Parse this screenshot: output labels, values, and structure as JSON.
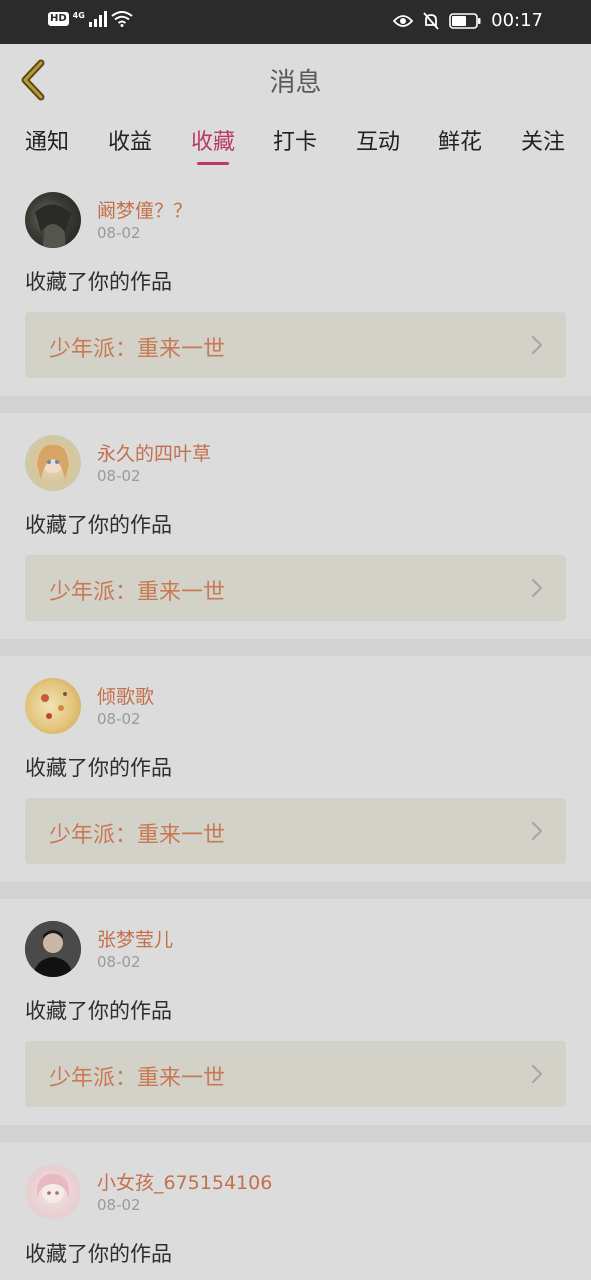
{
  "status_bar": {
    "hd": "HD",
    "network": "4G",
    "time": "00:17"
  },
  "header": {
    "title": "消息"
  },
  "tabs": [
    {
      "label": "通知"
    },
    {
      "label": "收益"
    },
    {
      "label": "收藏"
    },
    {
      "label": "打卡"
    },
    {
      "label": "互动"
    },
    {
      "label": "鲜花"
    },
    {
      "label": "关注"
    }
  ],
  "active_tab": "收藏",
  "colors": {
    "accent": "#b93a68",
    "username": "#c2714c",
    "work_title": "#c97a55"
  },
  "items": [
    {
      "username": "阚梦僮？？",
      "date": "08-02",
      "action": "收藏了你的作品",
      "work": "少年派：重来一世"
    },
    {
      "username": "永久的四叶草",
      "date": "08-02",
      "action": "收藏了你的作品",
      "work": "少年派：重来一世"
    },
    {
      "username": "倾歌歌",
      "date": "08-02",
      "action": "收藏了你的作品",
      "work": "少年派：重来一世"
    },
    {
      "username": "张梦莹儿",
      "date": "08-02",
      "action": "收藏了你的作品",
      "work": "少年派：重来一世"
    },
    {
      "username": "小女孩_675154106",
      "date": "08-02",
      "action": "收藏了你的作品",
      "work": ""
    }
  ]
}
